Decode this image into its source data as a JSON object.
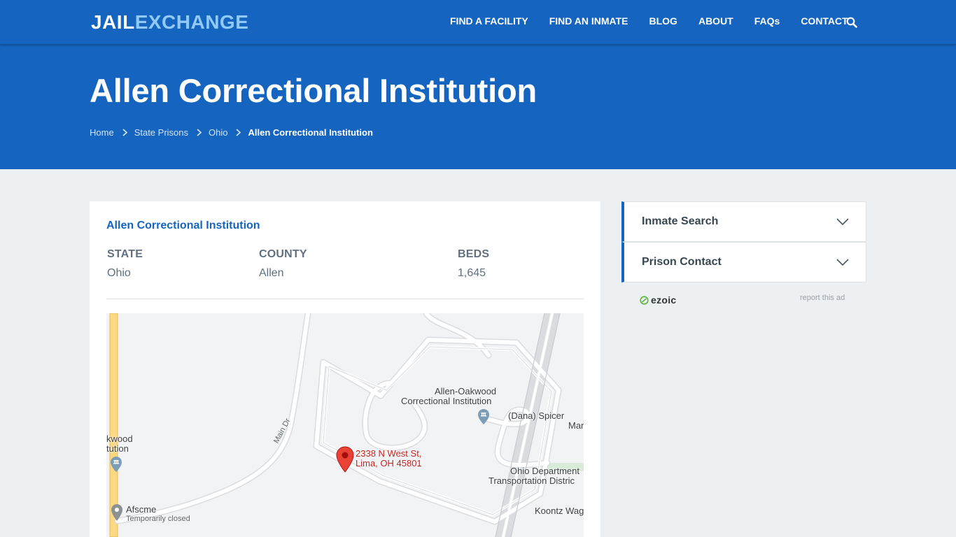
{
  "brand": {
    "part1": "JAIL",
    "part2": "EXCHANGE",
    "primary_color": "#1565c0",
    "accent_color": "#90caf9"
  },
  "nav": {
    "items": [
      {
        "label": "FIND A FACILITY"
      },
      {
        "label": "FIND AN INMATE"
      },
      {
        "label": "BLOG"
      },
      {
        "label": "ABOUT"
      },
      {
        "label": "FAQs"
      },
      {
        "label": "CONTACT"
      }
    ],
    "search_icon": "search-icon"
  },
  "hero": {
    "title": "Allen Correctional Institution",
    "breadcrumb": [
      {
        "label": "Home"
      },
      {
        "label": "State Prisons"
      },
      {
        "label": "Ohio"
      },
      {
        "label": "Allen Correctional Institution"
      }
    ]
  },
  "facility": {
    "name": "Allen Correctional Institution",
    "fields": [
      {
        "label": "STATE",
        "value": "Ohio"
      },
      {
        "label": "COUNTY",
        "value": "Allen"
      },
      {
        "label": "BEDS",
        "value": "1,645"
      }
    ]
  },
  "map": {
    "marker_address_line1": "2338 N West St,",
    "marker_address_line2": "Lima, OH 45801",
    "labels": {
      "allen_oakwood_1": "Allen-Oakwood",
      "allen_oakwood_2": "Correctional Institution",
      "dana_1": "(Dana) Spicer",
      "dana_2": "Man",
      "odot_1": "Ohio Department",
      "odot_2": "Transportation Distric",
      "koontz": "Koontz Wag",
      "oakwood_left_1": "kwood",
      "oakwood_left_2": "tution",
      "main_dr": "Main Dr",
      "afscme": "Afscme",
      "afscme_status": "Temporarily closed"
    }
  },
  "sidebar": {
    "accordions": [
      {
        "label": "Inmate Search"
      },
      {
        "label": "Prison Contact"
      }
    ],
    "ad": {
      "brand": "ezoic",
      "report_text": "report this ad"
    }
  }
}
